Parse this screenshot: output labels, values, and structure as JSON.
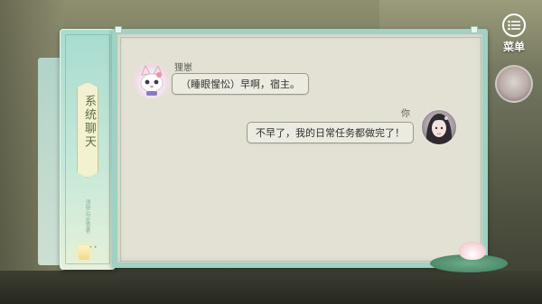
{
  "side_tab": {
    "title": "系统聊天",
    "subtitle": "须臾·与化雪者",
    "dots": "• • •"
  },
  "menu": {
    "label": "菜单",
    "icon": "list-icon"
  },
  "messages": [
    {
      "speaker": "狸崽",
      "text": "（睡眼惺忪）早啊，宿主。",
      "avatar": "cat-avatar-icon",
      "side": "left"
    },
    {
      "speaker": "你",
      "text": "不早了，我的日常任务都做完了！",
      "avatar": "girl-avatar-icon",
      "side": "right"
    }
  ],
  "colors": {
    "frame": "#9fd2c3",
    "paper": "#e2e1d4",
    "bubble_border": "#9c9a8c",
    "text": "#2f2f2c"
  }
}
